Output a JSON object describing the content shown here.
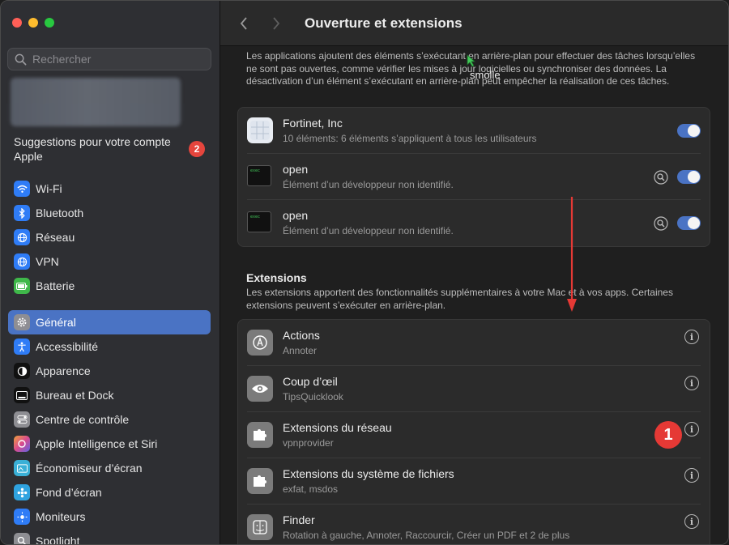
{
  "window_title": "Ouverture et extensions",
  "search": {
    "placeholder": "Rechercher"
  },
  "account": {
    "suggestion": "Suggestions pour votre compte Apple",
    "badge": "2"
  },
  "sidebar": {
    "items": [
      {
        "label": "Wi-Fi",
        "icon": "wifi-icon",
        "color": "#2f7cf6"
      },
      {
        "label": "Bluetooth",
        "icon": "bluetooth-icon",
        "color": "#2f7cf6"
      },
      {
        "label": "Réseau",
        "icon": "globe-icon",
        "color": "#2f7cf6"
      },
      {
        "label": "VPN",
        "icon": "vpn-globe-icon",
        "color": "#2f7cf6"
      },
      {
        "label": "Batterie",
        "icon": "battery-icon",
        "color": "#3fb84a"
      },
      {
        "label": "Général",
        "icon": "gear-icon",
        "color": "#8e8e93",
        "active": true
      },
      {
        "label": "Accessibilité",
        "icon": "accessibility-icon",
        "color": "#2f7cf6"
      },
      {
        "label": "Apparence",
        "icon": "appearance-icon",
        "color": "#111111"
      },
      {
        "label": "Bureau et Dock",
        "icon": "dock-icon",
        "color": "#111111"
      },
      {
        "label": "Centre de contrôle",
        "icon": "control-center-icon",
        "color": "#8e8e93"
      },
      {
        "label": "Apple Intelligence et Siri",
        "icon": "siri-icon",
        "color": "#c0509e"
      },
      {
        "label": "Économiseur d’écran",
        "icon": "screensaver-icon",
        "color": "#3ab0d6"
      },
      {
        "label": "Fond d’écran",
        "icon": "wallpaper-icon",
        "color": "#2fa3e0"
      },
      {
        "label": "Moniteurs",
        "icon": "display-icon",
        "color": "#2f7cf6"
      },
      {
        "label": "Spotlight",
        "icon": "spotlight-icon",
        "color": "#8e8e93"
      }
    ]
  },
  "background_items": {
    "description": "Les applications ajoutent des éléments s’exécutant en arrière-plan pour effectuer des tâches lorsqu’elles ne sont pas ouvertes, comme vérifier les mises à jour logicielles ou synchroniser des données. La désactivation d’un élément s’exécutant en arrière-plan peut empêcher la réalisation de ces tâches.",
    "items": [
      {
        "title": "Fortinet, Inc",
        "subtitle": "10 éléments: 6 éléments s’appliquent à tous les utilisateurs",
        "enabled": true
      },
      {
        "title": "open",
        "subtitle": "Élément d’un développeur non identifié.",
        "enabled": true
      },
      {
        "title": "open",
        "subtitle": "Élément d’un développeur non identifié.",
        "enabled": true
      }
    ]
  },
  "extensions": {
    "title": "Extensions",
    "description": "Les extensions apportent des fonctionnalités supplémentaires à votre Mac et à vos apps. Certaines extensions peuvent s’exécuter en arrière-plan.",
    "items": [
      {
        "title": "Actions",
        "subtitle": "Annoter"
      },
      {
        "title": "Coup d’œil",
        "subtitle": "TipsQuicklook"
      },
      {
        "title": "Extensions du réseau",
        "subtitle": "vpnprovider"
      },
      {
        "title": "Extensions du système de fichiers",
        "subtitle": "exfat, msdos"
      },
      {
        "title": "Finder",
        "subtitle": "Rotation à gauche, Annoter, Raccourcir, Créer un PDF et 2 de plus"
      }
    ]
  },
  "annotation": {
    "badge": "1"
  },
  "cursor_label": "smolle",
  "accent_color": "#4a73c4"
}
